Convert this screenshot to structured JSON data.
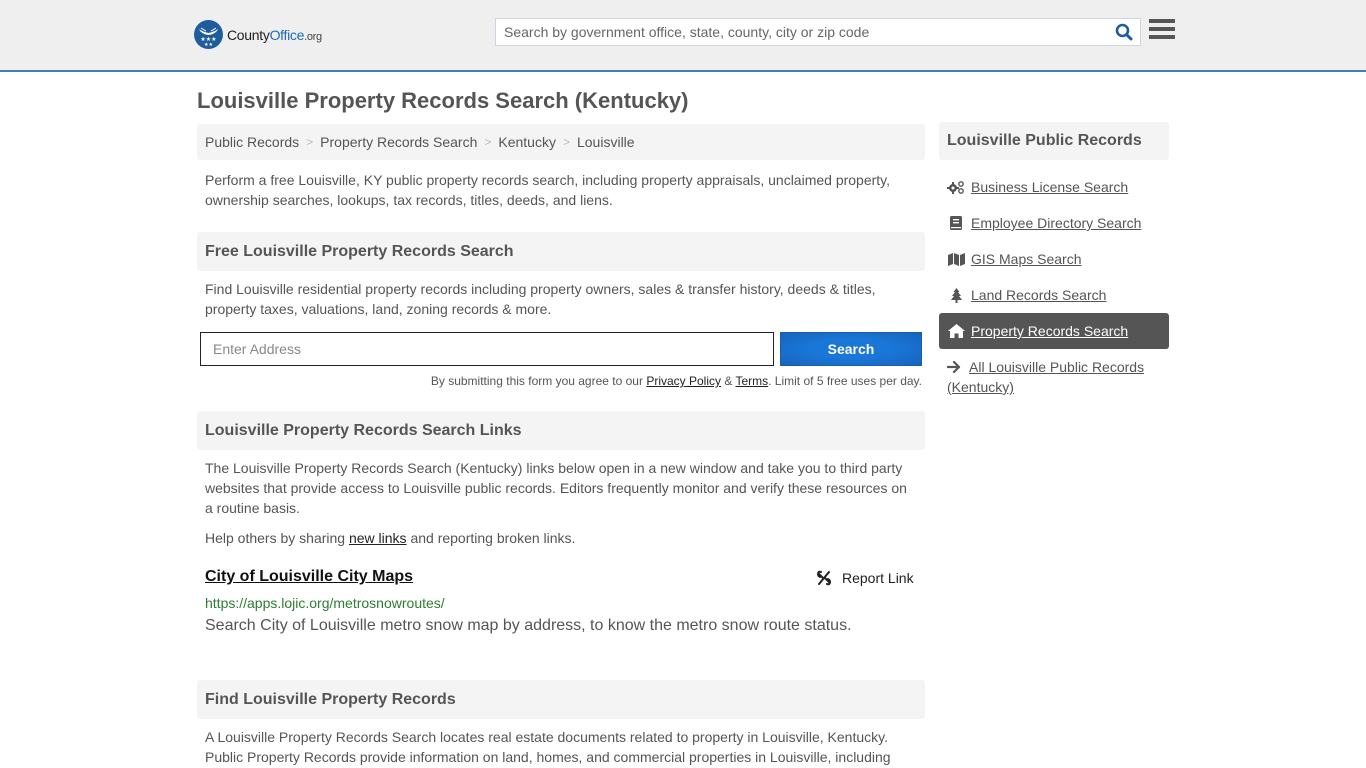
{
  "header": {
    "logo": {
      "name_part1": "County",
      "name_part2": "Office",
      "name_suffix": ".org"
    },
    "search_placeholder": "Search by government office, state, county, city or zip code",
    "search_icon": "search-icon",
    "menu_icon": "hamburger-menu-icon"
  },
  "page": {
    "title": "Louisville Property Records Search (Kentucky)",
    "breadcrumb": [
      "Public Records",
      "Property Records Search",
      "Kentucky",
      "Louisville"
    ],
    "breadcrumb_separator": ">",
    "intro": "Perform a free Louisville, KY public property records search, including property appraisals, unclaimed property, ownership searches, lookups, tax records, titles, deeds, and liens."
  },
  "free_search": {
    "heading": "Free Louisville Property Records Search",
    "description": "Find Louisville residential property records including property owners, sales & transfer history, deeds & titles, property taxes, valuations, land, zoning records & more.",
    "address_placeholder": "Enter Address",
    "button_label": "Search",
    "disclaimer_prefix": "By submitting this form you agree to our ",
    "privacy_label": "Privacy Policy",
    "amp": " & ",
    "terms_label": "Terms",
    "disclaimer_suffix": ". Limit of 5 free uses per day."
  },
  "links_section": {
    "heading": "Louisville Property Records Search Links",
    "description": "The Louisville Property Records Search (Kentucky) links below open in a new window and take you to third party websites that provide access to Louisville public records. Editors frequently monitor and verify these resources on a routine basis.",
    "help_prefix": "Help others by sharing ",
    "help_link": "new links",
    "help_suffix": " and reporting broken links.",
    "links": [
      {
        "title": "City of Louisville City Maps",
        "url": "https://apps.lojic.org/metrosnowroutes/",
        "description": "Search City of Louisville metro snow map by address, to know the metro snow route status.",
        "report_label": "Report Link"
      }
    ]
  },
  "find_section": {
    "heading": "Find Louisville Property Records",
    "text": "A Louisville Property Records Search locates real estate documents related to property in Louisville, Kentucky. Public Property Records provide information on land, homes, and commercial properties in Louisville, including"
  },
  "sidebar": {
    "heading": "Louisville Public Records",
    "items": [
      {
        "label": "Business License Search",
        "icon": "gears-icon",
        "active": false
      },
      {
        "label": "Employee Directory Search",
        "icon": "book-icon",
        "active": false
      },
      {
        "label": "GIS Maps Search",
        "icon": "map-icon",
        "active": false
      },
      {
        "label": "Land Records Search",
        "icon": "tree-icon",
        "active": false
      },
      {
        "label": "Property Records Search",
        "icon": "home-icon",
        "active": true
      }
    ],
    "all_link": "All Louisville Public Records (Kentucky)"
  },
  "colors": {
    "accent_blue": "#1f5c9e",
    "header_border": "#3a7fb5",
    "button_blue": "#1a77d8",
    "url_green": "#2e7d32",
    "active_sidebar": "#555555"
  }
}
